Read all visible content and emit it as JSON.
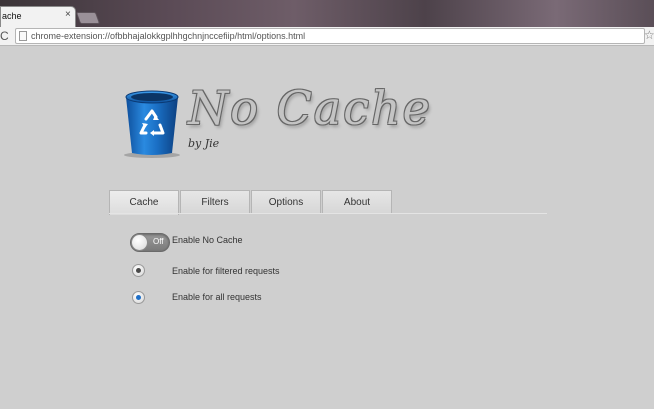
{
  "browser": {
    "tab_title": "ache",
    "tab_close": "×",
    "url": "chrome-extension://ofbbhajalokkgplhhgchnjnccefiip/html/options.html",
    "reload_glyph": "C",
    "star_glyph": "☆"
  },
  "logo": {
    "title": "No Cache",
    "byline": "by Jie",
    "icon": "recycle-bin-icon"
  },
  "tabs": [
    "Cache",
    "Filters",
    "Options",
    "About"
  ],
  "settings": {
    "enable_toggle": {
      "label": "Enable No Cache",
      "state_text": "Off"
    },
    "radio_filtered": {
      "label": "Enable for filtered requests",
      "selected": false
    },
    "radio_all": {
      "label": "Enable for all requests",
      "selected": true
    }
  },
  "colors": {
    "page_bg": "#cfcfcf",
    "bin_blue": "#1a6fc4",
    "radio_filtered_dot": "#4a4a4a",
    "radio_all_dot": "#1e6fc8"
  }
}
